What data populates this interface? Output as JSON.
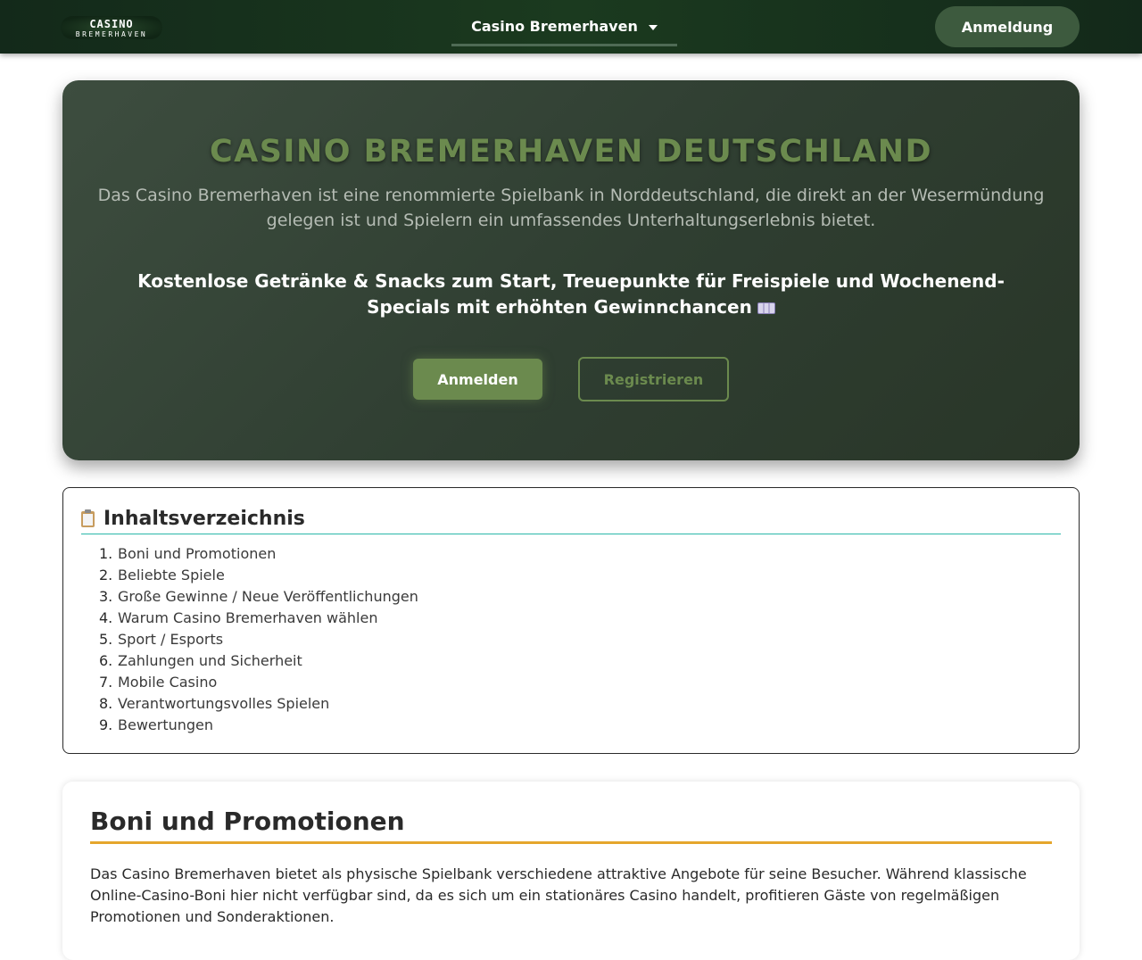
{
  "header": {
    "logo_line1": "CASINO",
    "logo_line2": "BREMERHAVEN",
    "nav_label": "Casino Bremerhaven",
    "login_label": "Anmeldung"
  },
  "hero": {
    "title": "CASINO BREMERHAVEN DEUTSCHLAND",
    "lead": "Das Casino Bremerhaven ist eine renommierte Spielbank in Norddeutschland, die direkt an der Wesermündung gelegen ist und Spielern ein umfassendes Unterhaltungserlebnis bietet.",
    "offer": "Kostenlose Getränke & Snacks zum Start, Treuepunkte für Freispiele und Wochenend-Specials mit erhöhten Gewinnchancen",
    "primary_cta": "Anmelden",
    "secondary_cta": "Registrieren",
    "offer_icon": "slot-machine-icon"
  },
  "toc": {
    "title": "Inhaltsverzeichnis",
    "title_icon": "clipboard-icon",
    "items": [
      {
        "num": "1.",
        "label": "Boni und Promotionen"
      },
      {
        "num": "2.",
        "label": "Beliebte Spiele"
      },
      {
        "num": "3.",
        "label": "Große Gewinne / Neue Veröffentlichungen"
      },
      {
        "num": "4.",
        "label": "Warum Casino Bremerhaven wählen"
      },
      {
        "num": "5.",
        "label": "Sport / Esports"
      },
      {
        "num": "6.",
        "label": "Zahlungen und Sicherheit"
      },
      {
        "num": "7.",
        "label": "Mobile Casino"
      },
      {
        "num": "8.",
        "label": "Verantwortungsvolles Spielen"
      },
      {
        "num": "9.",
        "label": "Bewertungen"
      }
    ]
  },
  "section": {
    "title": "Boni und Promotionen",
    "text": "Das Casino Bremerhaven bietet als physische Spielbank verschiedene attraktive Angebote für seine Besucher. Während klassische Online-Casino-Boni hier nicht verfügbar sind, da es sich um ein stationäres Casino handelt, profitieren Gäste von regelmäßigen Promotionen und Sonderaktionen."
  },
  "colors": {
    "header_bg": "#1b3a1f",
    "accent_green": "#6b8a4e",
    "toc_underline": "#2ab7a9",
    "section_underline": "#e5a62c"
  }
}
